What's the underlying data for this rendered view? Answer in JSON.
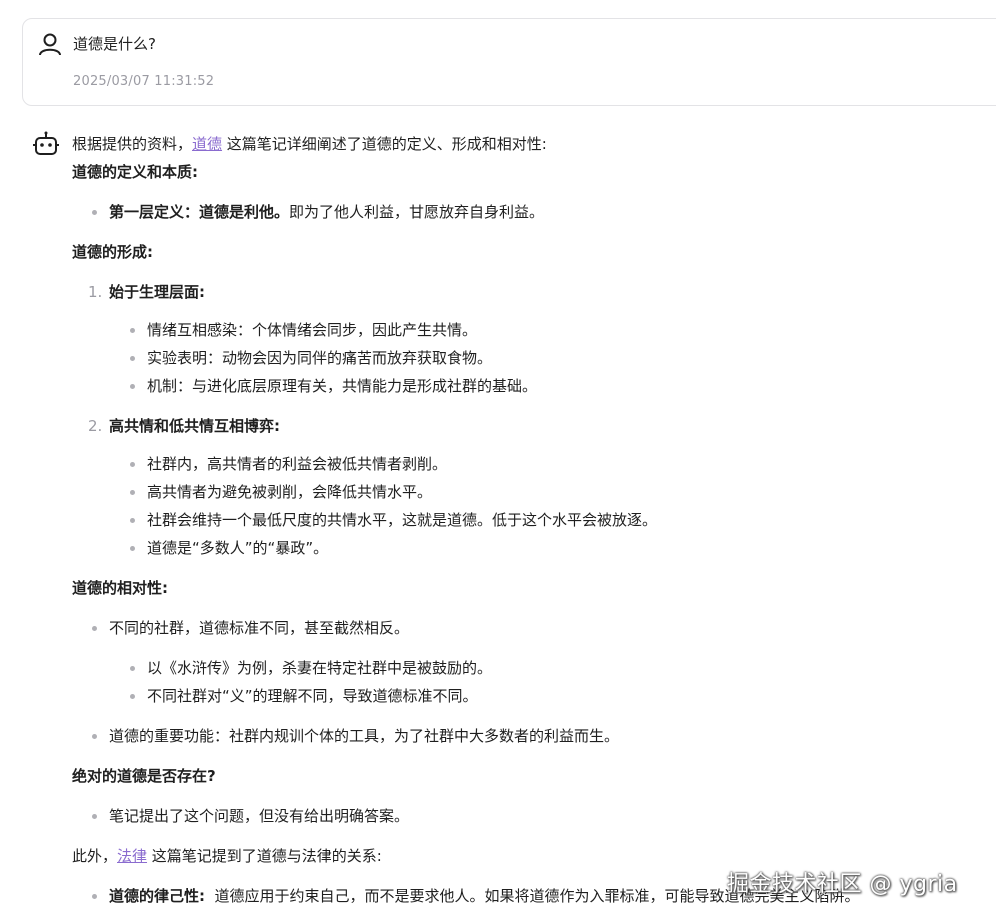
{
  "user_message": {
    "question": "道德是什么?",
    "timestamp": "2025/03/07 11:31:52"
  },
  "answer": {
    "intro_prefix": "根据提供的资料，",
    "intro_link": "道德",
    "intro_suffix": " 这篇笔记详细阐述了道德的定义、形成和相对性:",
    "sec1_title": "道德的定义和本质:",
    "sec1_b1_bold": "第一层定义：道德是利他。",
    "sec1_b1_text": "即为了他人利益，甘愿放弃自身利益。",
    "sec2_title": "道德的形成:",
    "sec2_i1_num": "1.",
    "sec2_i1_title": "始于生理层面:",
    "sec2_i1_bullets": [
      "情绪互相感染：个体情绪会同步，因此产生共情。",
      "实验表明：动物会因为同伴的痛苦而放弃获取食物。",
      "机制：与进化底层原理有关，共情能力是形成社群的基础。"
    ],
    "sec2_i2_num": "2.",
    "sec2_i2_title": "高共情和低共情互相博弈:",
    "sec2_i2_bullets": [
      "社群内，高共情者的利益会被低共情者剥削。",
      "高共情者为避免被剥削，会降低共情水平。",
      "社群会维持一个最低尺度的共情水平，这就是道德。低于这个水平会被放逐。",
      "道德是“多数人”的“暴政”。"
    ],
    "sec3_title": "道德的相对性:",
    "sec3_b1": "不同的社群，道德标准不同，甚至截然相反。",
    "sec3_b1_sub": [
      "以《水浒传》为例，杀妻在特定社群中是被鼓励的。",
      "不同社群对“义”的理解不同，导致道德标准不同。"
    ],
    "sec3_b2": "道德的重要功能：社群内规训个体的工具，为了社群中大多数者的利益而生。",
    "sec4_title": "绝对的道德是否存在?",
    "sec4_b1": "笔记提出了这个问题，但没有给出明确答案。",
    "outro_prefix": "此外，",
    "outro_link": "法律",
    "outro_suffix": " 这篇笔记提到了道德与法律的关系:",
    "sec5_b1_bold": "道德的律己性:",
    "sec5_b1_text": "  道德应用于约束自己，而不是要求他人。如果将道德作为入罪标准，可能导致道德完美主义陷阱。"
  },
  "watermark": "掘金技术社区 @ ygria",
  "icons": {
    "user": "user-icon",
    "bot": "robot-icon"
  },
  "colors": {
    "link": "#8a6bcf",
    "muted": "#9b9ba3",
    "border": "#e3e3e6"
  }
}
